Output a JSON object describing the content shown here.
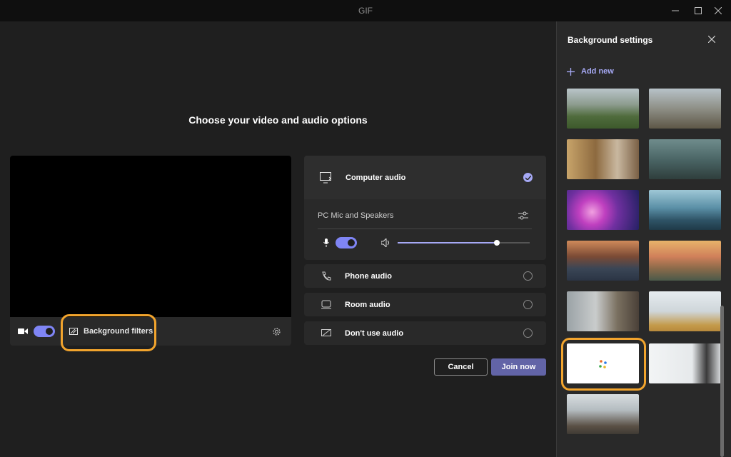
{
  "window": {
    "title": "GIF"
  },
  "main": {
    "heading": "Choose your video and audio options"
  },
  "video_bar": {
    "background_filters_label": "Background filters"
  },
  "audio": {
    "computer_audio_label": "Computer audio",
    "device_label": "PC Mic and Speakers",
    "speaker_volume": 0.75,
    "options": [
      {
        "label": "Phone audio"
      },
      {
        "label": "Room audio"
      },
      {
        "label": "Don't use audio"
      }
    ]
  },
  "actions": {
    "cancel_label": "Cancel",
    "join_label": "Join now"
  },
  "sidebar": {
    "title": "Background settings",
    "add_new_label": "Add new"
  },
  "colors": {
    "accent": "#7f85f5",
    "highlight": "#f2a42d",
    "background": "#1f1f1f"
  }
}
